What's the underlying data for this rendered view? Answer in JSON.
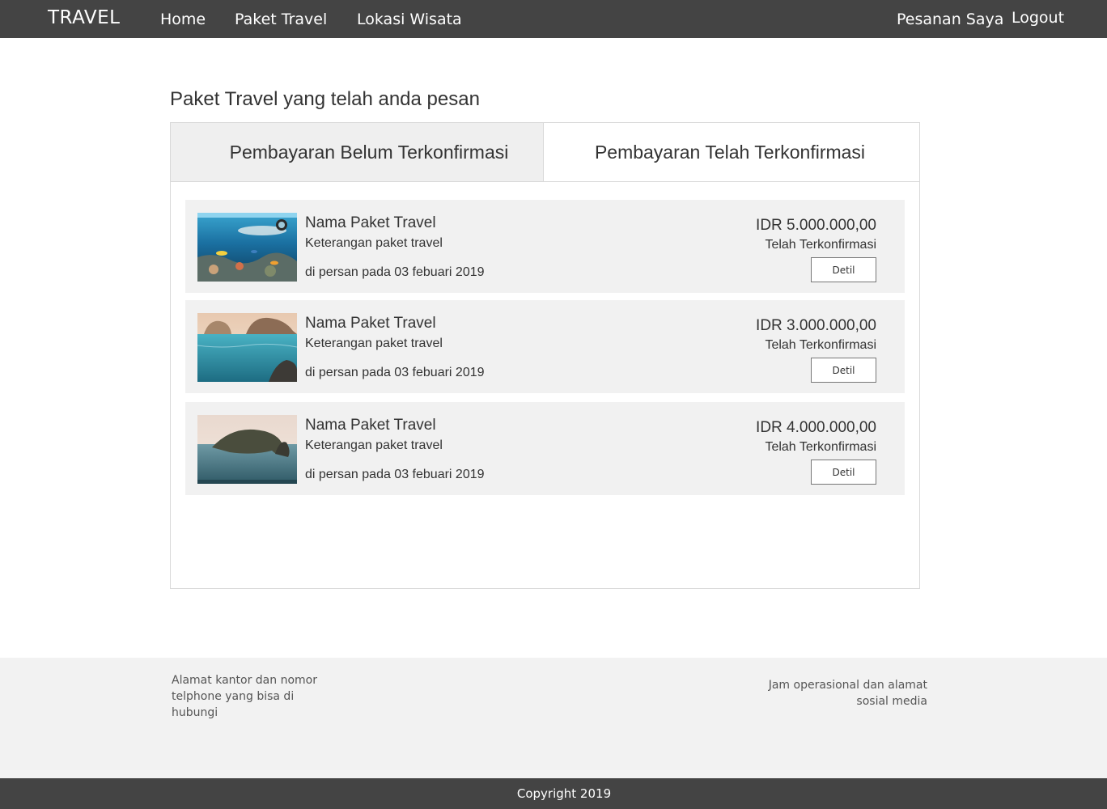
{
  "navbar": {
    "brand": "TRAVEL",
    "links": [
      "Home",
      "Paket Travel",
      "Lokasi Wisata"
    ],
    "pesanan": "Pesanan Saya",
    "logout": "Logout"
  },
  "page": {
    "title": "Paket Travel yang telah anda pesan"
  },
  "tabs": {
    "belum": "Pembayaran Belum Terkonfirmasi",
    "telah": "Pembayaran Telah Terkonfirmasi",
    "active": "telah"
  },
  "orders": [
    {
      "name": "Nama Paket Travel",
      "description": "Keterangan paket travel",
      "date": "di persan pada 03 febuari 2019",
      "price": "IDR 5.000.000,00",
      "status": "Telah Terkonfirmasi",
      "button": "Detil",
      "image": "snorkeling-reef-photo"
    },
    {
      "name": "Nama Paket Travel",
      "description": "Keterangan paket travel",
      "date": "di persan pada 03 febuari 2019",
      "price": "IDR 3.000.000,00",
      "status": "Telah Terkonfirmasi",
      "button": "Detil",
      "image": "sea-rocks-photo"
    },
    {
      "name": "Nama Paket Travel",
      "description": "Keterangan paket travel",
      "date": "di persan pada 03 febuari 2019",
      "price": "IDR 4.000.000,00",
      "status": "Telah Terkonfirmasi",
      "button": "Detil",
      "image": "coastal-cliff-photo"
    }
  ],
  "footer": {
    "left": "Alamat kantor dan nomor telphone yang bisa di hubungi",
    "right": "Jam operasional dan alamat sosial media",
    "copyright": "Copyright 2019"
  },
  "colors": {
    "navbar": "#444444",
    "tab_inactive": "#efefef",
    "card_bg": "#f1f1f1",
    "footer_bg": "#f2f2f2"
  }
}
